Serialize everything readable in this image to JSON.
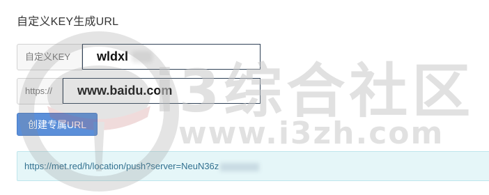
{
  "page": {
    "title": "自定义KEY生成URL"
  },
  "form": {
    "key_addon": "自定义KEY",
    "key_value": "wldxl",
    "url_addon": "https://",
    "url_value": "www.baidu.com",
    "submit_label": "创建专属URL"
  },
  "result": {
    "url": "https://met.red/h/location/push?server=NeuN36z"
  },
  "watermark": {
    "brand": "i3综合社区",
    "site": "www.i3zh.com",
    "icon": "chef-hat-logo"
  },
  "colors": {
    "button": "#5b8fd9",
    "result_bg": "#e5f6f8",
    "result_text": "#31708f"
  }
}
